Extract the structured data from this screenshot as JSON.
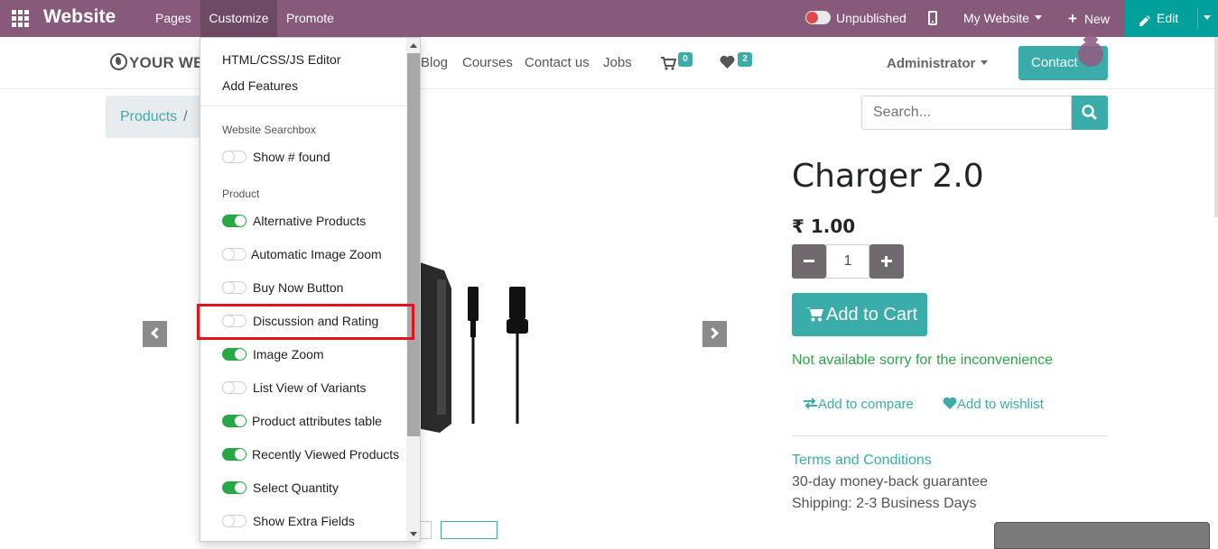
{
  "topbar": {
    "brand": "Website",
    "menus": [
      "Pages",
      "Customize",
      "Promote"
    ],
    "publish_status": "Unpublished",
    "website_selector": "My Website",
    "new_label": "New",
    "edit_label": "Edit",
    "colors": {
      "bar": "#875a7b",
      "active_menu": "#6e4964",
      "edit": "#00a09d",
      "unpublished": "#e04848"
    }
  },
  "header": {
    "logo": "YOUR WE",
    "nav": [
      "Blog",
      "Courses",
      "Contact us",
      "Jobs"
    ],
    "cart_count": "0",
    "wishlist_count": "2",
    "user": "Administrator",
    "contact_button": "Contact"
  },
  "breadcrumb": {
    "link": "Products",
    "separator": "/"
  },
  "search": {
    "placeholder": "Search..."
  },
  "product": {
    "title": "Charger 2.0",
    "price": "₹ 1.00",
    "quantity": "1",
    "add_to_cart": "Add to Cart",
    "availability": "Not available sorry for the inconvenience",
    "compare": "Add to compare",
    "wishlist": "Add to wishlist",
    "terms": "Terms and Conditions",
    "guarantee": "30-day money-back guarantee",
    "shipping": "Shipping: 2-3 Business Days"
  },
  "customize_menu": {
    "items": [
      "HTML/CSS/JS Editor",
      "Add Features"
    ],
    "sections": [
      {
        "header": "Website Searchbox",
        "options": [
          {
            "label": "Show # found",
            "on": false
          }
        ]
      },
      {
        "header": "Product",
        "options": [
          {
            "label": "Alternative Products",
            "on": true
          },
          {
            "label": "Automatic Image Zoom",
            "on": false
          },
          {
            "label": "Buy Now Button",
            "on": false
          },
          {
            "label": "Discussion and Rating",
            "on": false
          },
          {
            "label": "Image Zoom",
            "on": true
          },
          {
            "label": "List View of Variants",
            "on": false
          },
          {
            "label": "Product attributes table",
            "on": true
          },
          {
            "label": "Recently Viewed Products",
            "on": true
          },
          {
            "label": "Select Quantity",
            "on": true
          },
          {
            "label": "Show Extra Fields",
            "on": false
          }
        ]
      }
    ],
    "highlight_color": "#e0121b"
  }
}
